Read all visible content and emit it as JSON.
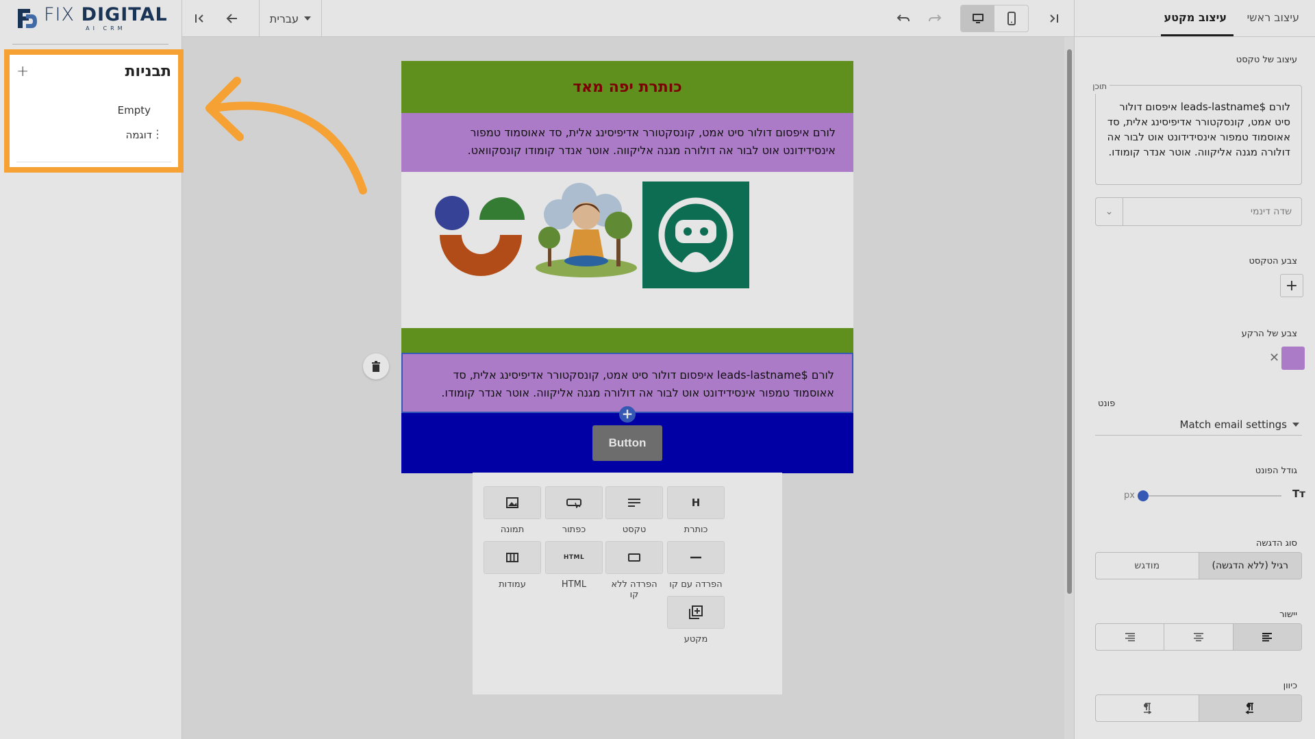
{
  "brand": {
    "name_light": "FIX ",
    "name_bold": "DIGITAL",
    "tagline": "AI CRM",
    "color": "#1e3a5f"
  },
  "templates": {
    "title": "תבניות",
    "add_icon": "plus-icon",
    "items": [
      "Empty",
      "דוגמה"
    ],
    "highlight_color": "#f6a133"
  },
  "toolbar": {
    "language": "עברית",
    "collapse_left_icon": "collapse-left-icon",
    "back_icon": "arrow-left-icon",
    "undo_icon": "undo-icon",
    "redo_icon": "redo-icon",
    "desktop_icon": "desktop-icon",
    "mobile_icon": "mobile-icon",
    "collapse_right_icon": "collapse-right-icon"
  },
  "email": {
    "header_title": "כותרת יפה מאד",
    "header_bg": "#6aa121",
    "header_color": "#8b0000",
    "text1": "לורם איפסום דולור סיט אמט, קונסקטורר אדיפיסינג אלית, סד אאוסמוד טמפור אינסידידונט אוט לבור אה דולורה מגנה אליקווה. אוטר אנדר קומודו קונסקוואט.",
    "text2": "לורם $leads-lastname איפסום דולור סיט אמט, קונסקטורר אדיפיסינג אלית, סד אאוסמוד טמפור אינסידידונט אוט לבור אה דולורה מגנה אליקווה. אוטר אנדר קומודו.",
    "text_bg": "#c089df",
    "button_label": "Button",
    "button_row_bg": "#0000b8"
  },
  "blocks": [
    {
      "label": "כותרת",
      "icon": "heading-icon"
    },
    {
      "label": "טקסט",
      "icon": "text-icon"
    },
    {
      "label": "כפתור",
      "icon": "button-icon"
    },
    {
      "label": "תמונה",
      "icon": "image-icon"
    },
    {
      "label": "הפרדה עם קו",
      "icon": "divider-line-icon"
    },
    {
      "label": "הפרדה ללא קו",
      "icon": "spacer-icon"
    },
    {
      "label": "HTML",
      "icon": "html-icon"
    },
    {
      "label": "עמודות",
      "icon": "columns-icon"
    },
    {
      "label": "מקטע",
      "icon": "section-icon"
    }
  ],
  "right_panel": {
    "tabs": [
      "עיצוב ראשי",
      "עיצוב מקטע"
    ],
    "active_tab": "עיצוב מקטע",
    "section_title": "עיצוב של טקסט",
    "content_label": "תוכן",
    "content_value": "לורם  $leads-lastname איפסום דולור סיט אמט, קונסקטורר אדיפיסינג אלית, סד אאוסמוד טמפור אינסידידונט אוט לבור אה דולורה מגנה אליקווה. אוטר אנדר קומודו.",
    "dynamic_field_placeholder": "שדה דינמי",
    "text_color_label": "צבע הטקסט",
    "bg_color_label": "צבע של הרקע",
    "bg_color_value": "#c089df",
    "font_label": "פונט",
    "font_value": "Match email settings",
    "font_size_label": "גודל הפונט",
    "font_size_unit": "px",
    "emphasis_label": "סוג הדגשה",
    "emphasis_options": [
      "רגיל (ללא הדגשה)",
      "מודגש"
    ],
    "emphasis_selected": "רגיל (ללא הדגשה)",
    "align_label": "יישור",
    "direction_label": "כיוון"
  }
}
